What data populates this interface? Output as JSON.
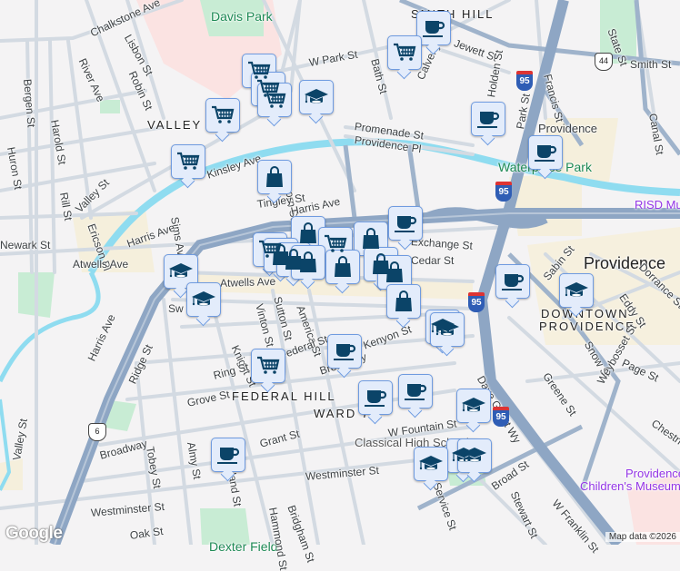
{
  "map": {
    "neighborhoods": [
      "SMITH HILL",
      "VALLEY",
      "FEDERAL HILL",
      "WARD 7",
      "DOWNTOWN",
      "PROVIDENCE"
    ],
    "parks": [
      "Davis Park",
      "Waterplace Park",
      "Dexter Field"
    ],
    "city": "Providence",
    "pois": [
      "Providence",
      "RISD Mu",
      "Providence",
      "Children's Museum",
      "Classical High School"
    ],
    "streets": [
      "Chalkstone Ave",
      "Lisbon St",
      "Robin St",
      "River Ave",
      "Bergen St",
      "Harold St",
      "Huron St",
      "Rill St",
      "Ericson Pl",
      "Valley St",
      "Sims Ave",
      "Kinsley Ave",
      "Acorn St",
      "Tingley St",
      "Harris Ave",
      "Atwells Ave",
      "W Park St",
      "Bath St",
      "Calverly St",
      "Jewett St",
      "Holden St",
      "Park St",
      "Francis St",
      "State St",
      "Smith St",
      "Canal St",
      "Promenade St",
      "Providence Pl",
      "Exchange St",
      "Cedar St",
      "Sabin St",
      "Eddy St",
      "Dorrance St",
      "Snow St",
      "Weybosset St",
      "Page St",
      "Greene St",
      "Chestnut St",
      "Dave Gavitt Wy",
      "W Fountain St",
      "Kenyon St",
      "Broadway",
      "Vinton St",
      "Sutton St",
      "America St",
      "Knight St",
      "Federal St",
      "Ring St",
      "Grove St",
      "Ridge St",
      "Grant St",
      "Courtland St",
      "Almy St",
      "Tobey St",
      "Westminster St",
      "Oak St",
      "Hammond St",
      "Bridgham St",
      "Broad St",
      "Stewart St",
      "W Franklin St",
      "Service St",
      "Newark St",
      "Sw"
    ],
    "shields": [
      "95",
      "95",
      "95",
      "44",
      "6"
    ],
    "attribution": "Map data ©2026",
    "logo": "Google"
  },
  "markers": {
    "types": [
      "grocery",
      "education",
      "cafe",
      "shopping"
    ],
    "colors": {
      "fill": "#e3ecfb",
      "border": "#6f9be0",
      "icon": "#0b4468",
      "highway": "#8ea6c4",
      "water": "#8fdcf0"
    }
  }
}
